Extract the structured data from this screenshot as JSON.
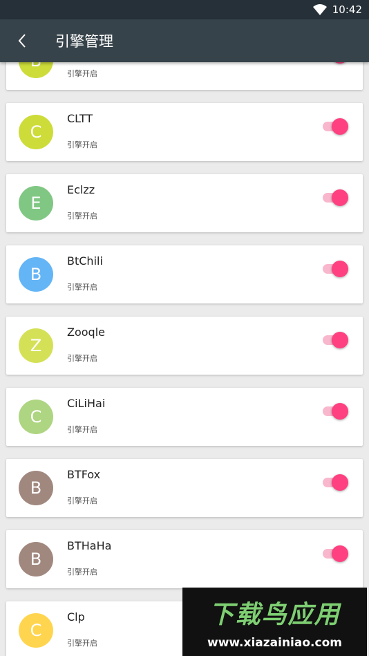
{
  "status_bar": {
    "time": "10:42"
  },
  "app_bar": {
    "title": "引擎管理"
  },
  "engines": [
    {
      "name": "",
      "letter": "B",
      "status": "引擎开启",
      "color": "#cddc39",
      "enabled": true
    },
    {
      "name": "CLTT",
      "letter": "C",
      "status": "引擎开启",
      "color": "#cddc39",
      "enabled": true
    },
    {
      "name": "Eclzz",
      "letter": "E",
      "status": "引擎开启",
      "color": "#81c784",
      "enabled": true
    },
    {
      "name": "BtChili",
      "letter": "B",
      "status": "引擎开启",
      "color": "#64b5f6",
      "enabled": true
    },
    {
      "name": "Zooqle",
      "letter": "Z",
      "status": "引擎开启",
      "color": "#d4e157",
      "enabled": true
    },
    {
      "name": "CiLiHai",
      "letter": "C",
      "status": "引擎开启",
      "color": "#aed581",
      "enabled": true
    },
    {
      "name": "BTFox",
      "letter": "B",
      "status": "引擎开启",
      "color": "#a1887f",
      "enabled": true
    },
    {
      "name": "BTHaHa",
      "letter": "B",
      "status": "引擎开启",
      "color": "#a1887f",
      "enabled": true
    },
    {
      "name": "Clp",
      "letter": "C",
      "status": "引擎开启",
      "color": "#ffd54f",
      "enabled": true
    }
  ],
  "watermark": {
    "title": "下载鸟应用",
    "url": "www.xiazainiao.com"
  }
}
